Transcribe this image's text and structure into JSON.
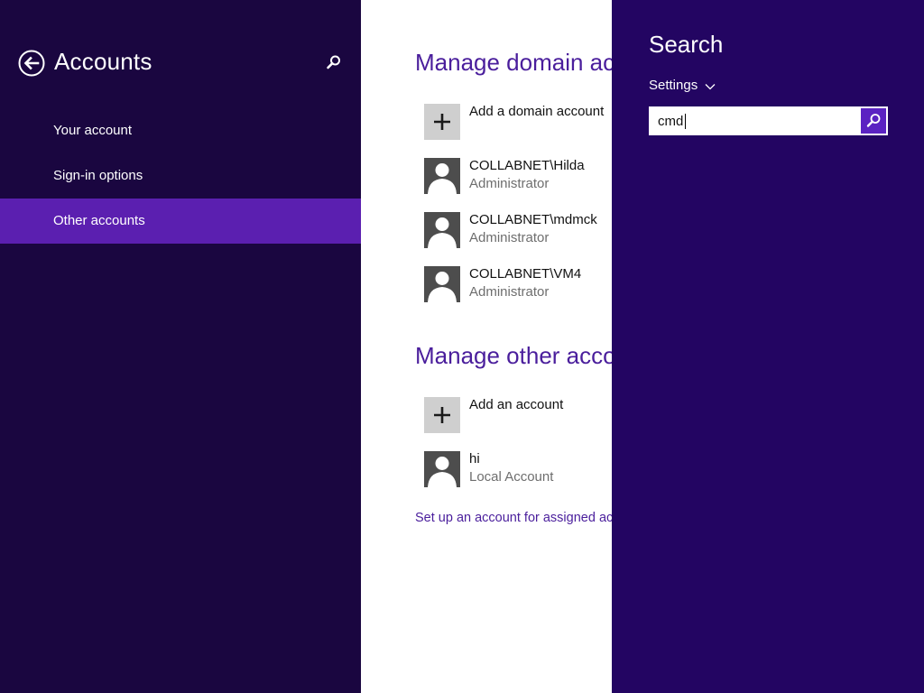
{
  "nav": {
    "title": "Accounts",
    "items": [
      {
        "label": "Your account"
      },
      {
        "label": "Sign-in options"
      },
      {
        "label": "Other accounts"
      }
    ]
  },
  "content": {
    "domain_section_title": "Manage domain accounts",
    "domain_accounts": [
      {
        "name": "Add a domain account",
        "type": ""
      },
      {
        "name": "COLLABNET\\Hilda",
        "type": "Administrator"
      },
      {
        "name": "COLLABNET\\mdmck",
        "type": "Administrator"
      },
      {
        "name": "COLLABNET\\VM4",
        "type": "Administrator"
      }
    ],
    "other_section_title": "Manage other accounts",
    "other_accounts": [
      {
        "name": "Add an account",
        "type": ""
      },
      {
        "name": "hi",
        "type": "Local Account"
      }
    ],
    "assigned_access_link": "Set up an account for assigned access"
  },
  "search": {
    "title": "Search",
    "scope": "Settings",
    "query": "cmd"
  },
  "colors": {
    "nav_bg": "#1a0640",
    "nav_selected": "#5b1fb0",
    "charm_bg": "#230562",
    "accent": "#4a1e9c"
  },
  "icons": {
    "back": "back-arrow-icon",
    "search": "magnifier-icon",
    "add": "plus-icon",
    "user": "user-silhouette-icon",
    "scope": "chevron-down-icon"
  }
}
